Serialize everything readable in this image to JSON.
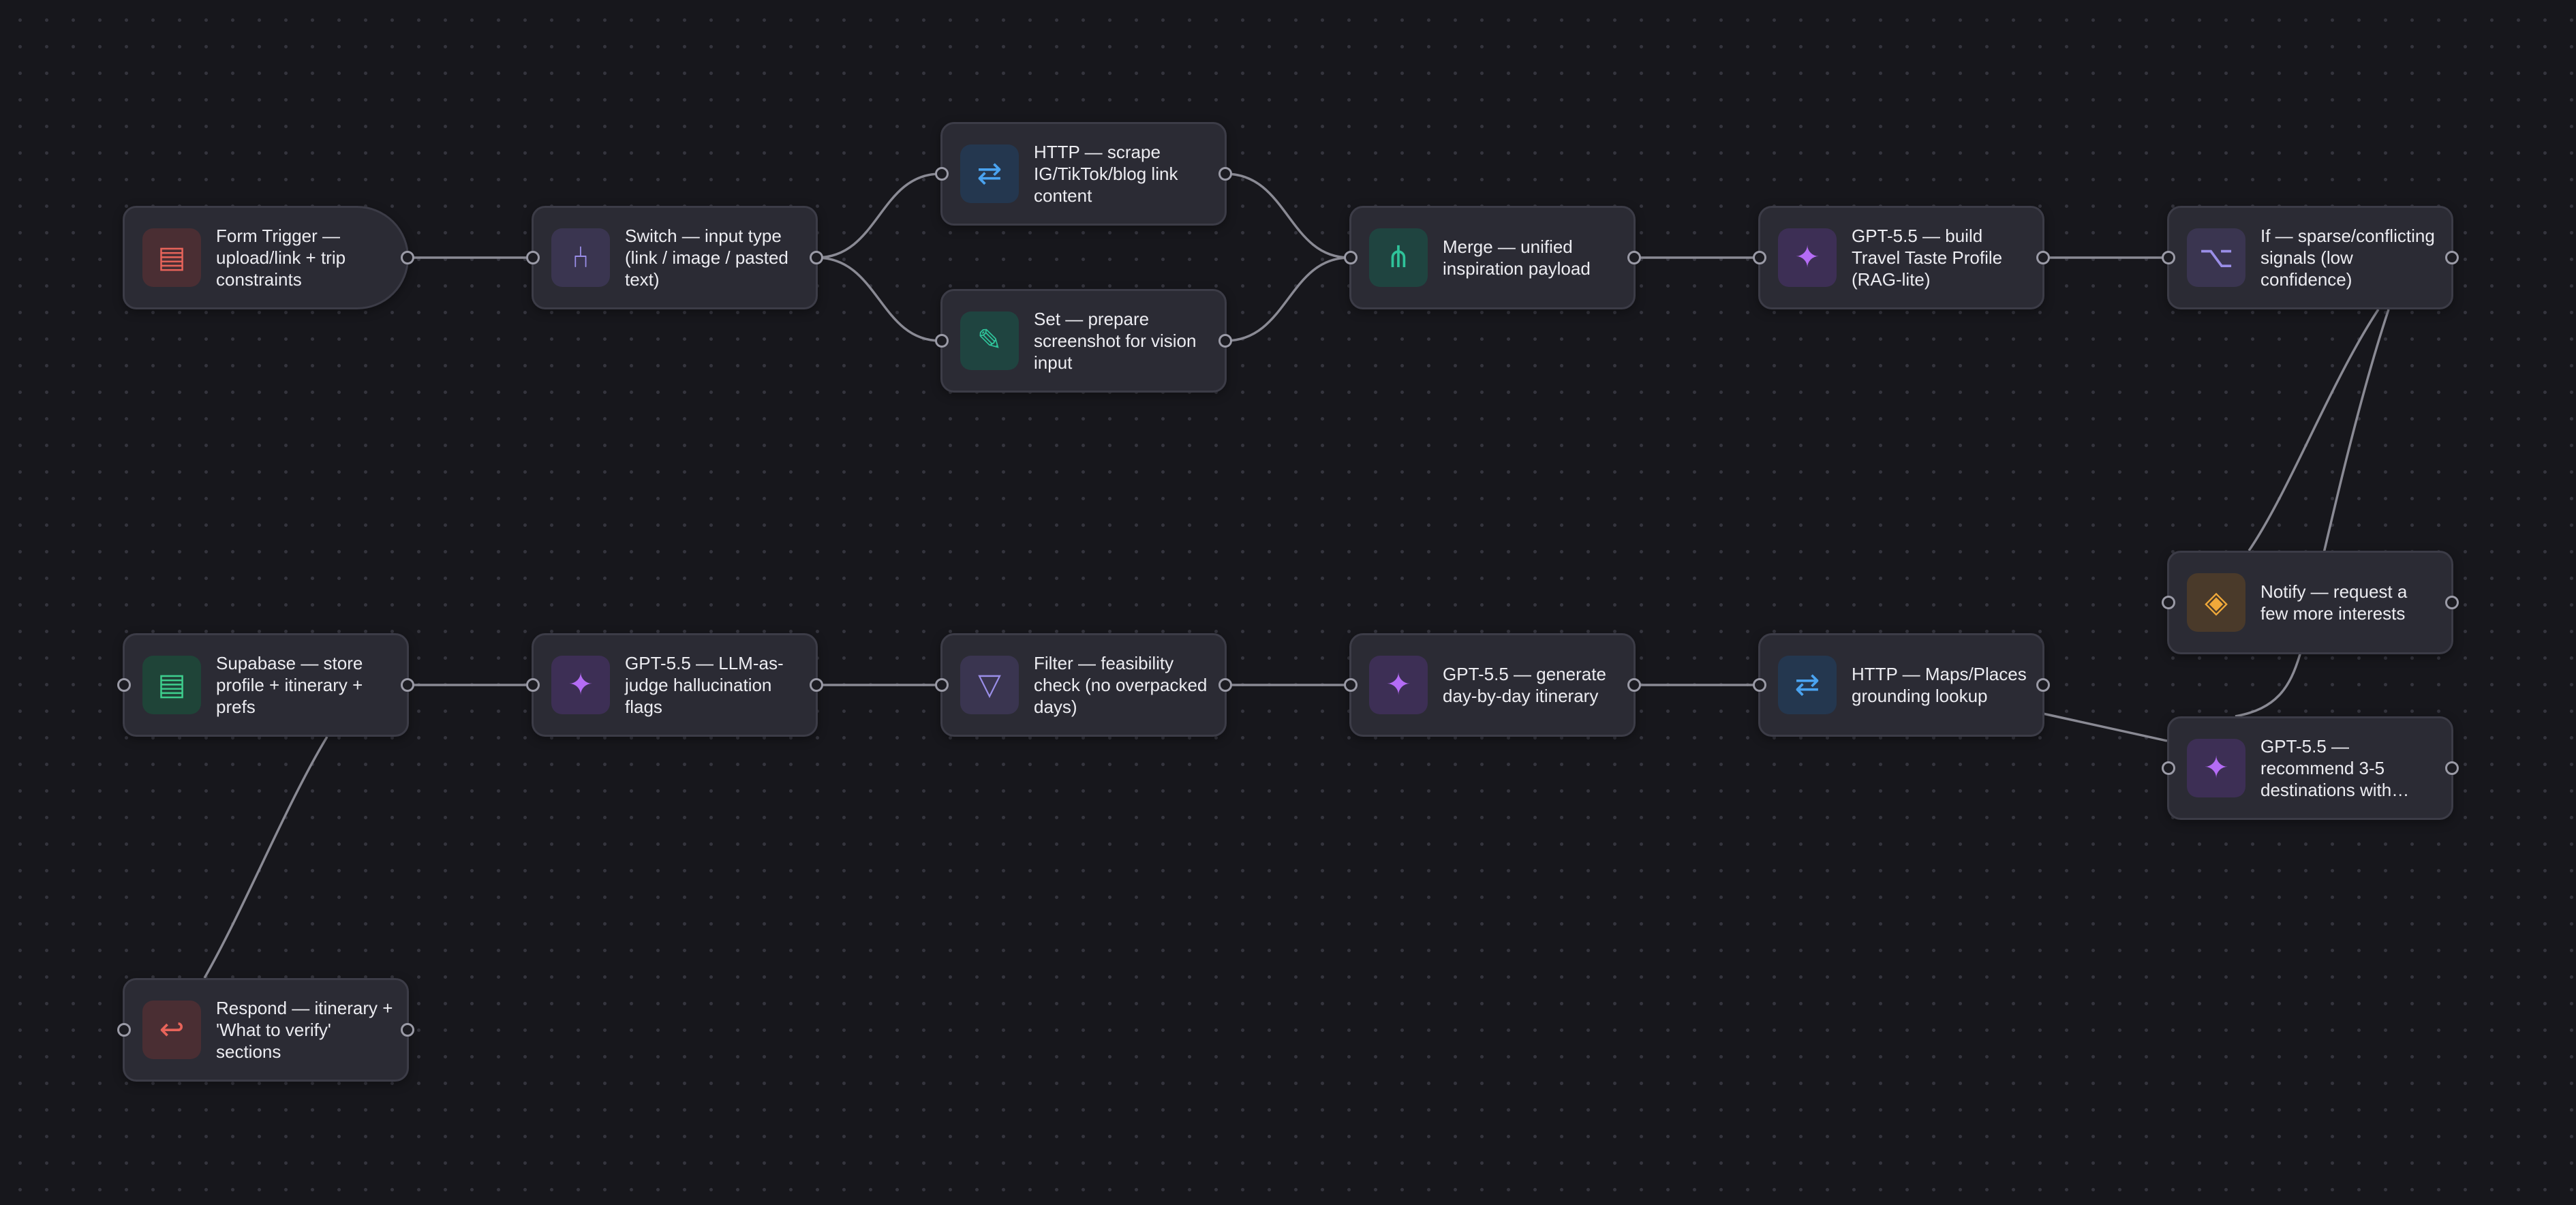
{
  "theme": {
    "edge_color": "#8a8a94",
    "node_background": "#2b2b34"
  },
  "nodes": [
    {
      "id": "form_trigger",
      "label": "Form Trigger — upload/link + trip constraints",
      "icon": "form-icon",
      "glyph": "▤",
      "icon_color": "#e8645a",
      "icon_bg": "#4a2e33"
    },
    {
      "id": "switch",
      "label": "Switch — input type (link / image / pasted text)",
      "icon": "switch-branch-icon",
      "glyph": "⑃",
      "icon_color": "#9a8ee8",
      "icon_bg": "#3a3550"
    },
    {
      "id": "http_scrape",
      "label": "HTTP — scrape IG/TikTok/blog link content",
      "icon": "http-exchange-icon",
      "glyph": "⇄",
      "icon_color": "#4aa3f0",
      "icon_bg": "#24374f"
    },
    {
      "id": "set_prepare",
      "label": "Set — prepare screenshot for vision input",
      "icon": "pencil-icon",
      "glyph": "✎",
      "icon_color": "#2fc39a",
      "icon_bg": "#1f4440"
    },
    {
      "id": "merge",
      "label": "Merge — unified inspiration payload",
      "icon": "merge-icon",
      "glyph": "⋔",
      "icon_color": "#2fc39a",
      "icon_bg": "#1f4440"
    },
    {
      "id": "gpt_profile",
      "label": "GPT-5.5 — build Travel Taste Profile (RAG-lite)",
      "icon": "sparkle-icon",
      "glyph": "✦",
      "icon_color": "#b46cf5",
      "icon_bg": "#3d2f55"
    },
    {
      "id": "if_sparse",
      "label": "If — sparse/conflicting signals (low confidence)",
      "icon": "if-branch-icon",
      "glyph": "⌥",
      "icon_color": "#9a8ee8",
      "icon_bg": "#3a3550"
    },
    {
      "id": "notify",
      "label": "Notify — request a few more interests",
      "icon": "notify-diamond-icon",
      "glyph": "◈",
      "icon_color": "#f0a93a",
      "icon_bg": "#4a3a2a"
    },
    {
      "id": "gpt_recommend",
      "label": "GPT-5.5 — recommend 3-5 destinations with…",
      "icon": "sparkle-icon",
      "glyph": "✦",
      "icon_color": "#b46cf5",
      "icon_bg": "#3d2f55"
    },
    {
      "id": "http_maps",
      "label": "HTTP — Maps/Places grounding lookup",
      "icon": "http-exchange-icon",
      "glyph": "⇄",
      "icon_color": "#4aa3f0",
      "icon_bg": "#24374f"
    },
    {
      "id": "gpt_itinerary",
      "label": "GPT-5.5 — generate day-by-day itinerary",
      "icon": "sparkle-icon",
      "glyph": "✦",
      "icon_color": "#b46cf5",
      "icon_bg": "#3d2f55"
    },
    {
      "id": "filter",
      "label": "Filter — feasibility check (no overpacked days)",
      "icon": "filter-icon",
      "glyph": "▽",
      "icon_color": "#9a8ee8",
      "icon_bg": "#3a3550"
    },
    {
      "id": "gpt_judge",
      "label": "GPT-5.5 — LLM-as-judge hallucination flags",
      "icon": "sparkle-icon",
      "glyph": "✦",
      "icon_color": "#b46cf5",
      "icon_bg": "#3d2f55"
    },
    {
      "id": "supabase",
      "label": "Supabase — store profile + itinerary + prefs",
      "icon": "database-table-icon",
      "glyph": "▤",
      "icon_color": "#3ecf8e",
      "icon_bg": "#1f4438"
    },
    {
      "id": "respond",
      "label": "Respond — itinerary + 'What to verify' sections",
      "icon": "return-arrow-icon",
      "glyph": "↩",
      "icon_color": "#e8645a",
      "icon_bg": "#4a2e33"
    }
  ],
  "connections": [
    {
      "from": "form_trigger",
      "to": "switch"
    },
    {
      "from": "switch",
      "to": "http_scrape"
    },
    {
      "from": "switch",
      "to": "set_prepare"
    },
    {
      "from": "http_scrape",
      "to": "merge"
    },
    {
      "from": "set_prepare",
      "to": "merge"
    },
    {
      "from": "merge",
      "to": "gpt_profile"
    },
    {
      "from": "gpt_profile",
      "to": "if_sparse"
    },
    {
      "from": "if_sparse",
      "to": "notify"
    },
    {
      "from": "if_sparse",
      "to": "gpt_recommend"
    },
    {
      "from": "gpt_recommend",
      "to": "http_maps"
    },
    {
      "from": "http_maps",
      "to": "gpt_itinerary"
    },
    {
      "from": "gpt_itinerary",
      "to": "filter"
    },
    {
      "from": "filter",
      "to": "gpt_judge"
    },
    {
      "from": "gpt_judge",
      "to": "supabase"
    },
    {
      "from": "supabase",
      "to": "respond"
    }
  ]
}
